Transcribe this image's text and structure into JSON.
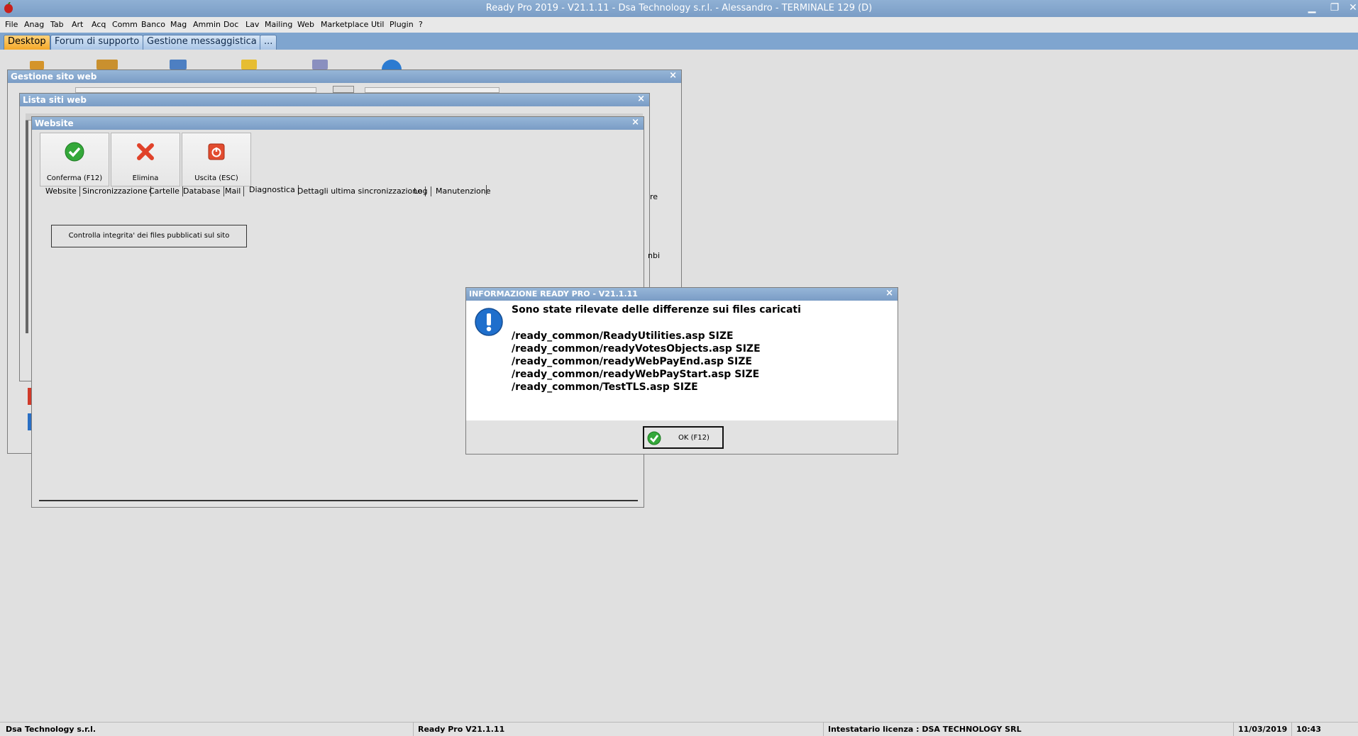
{
  "window": {
    "title": "Ready Pro 2019 - V21.1.11 - Dsa Technology s.r.l. - Alessandro - TERMINALE 129 (D)",
    "minimize_glyph": "▁",
    "restore_glyph": "❐",
    "close_glyph": "✕"
  },
  "menu": [
    "File",
    "Anag",
    "Tab",
    "Art",
    "Acq",
    "Comm",
    "Banco",
    "Mag",
    "Ammin",
    "Doc",
    "Lav",
    "Mailing",
    "Web",
    "Marketplace",
    "Util",
    "Plugin",
    "?"
  ],
  "tabs": [
    "Desktop",
    "Forum di supporto",
    "Gestione messaggistica",
    "..."
  ],
  "gestione_sito": {
    "title": "Gestione sito web"
  },
  "lista_siti": {
    "title": "Lista siti web",
    "side_text_1": "re",
    "side_text_2": "nbi"
  },
  "website": {
    "title": "Website",
    "buttons": [
      "Conferma (F12)",
      "Elimina",
      "Uscita (ESC)"
    ],
    "tabs": [
      "Website",
      "Sincronizzazione",
      "Cartelle",
      "Database",
      "Mail",
      "Diagnostica",
      "Dettagli ultima sincronizzazione",
      "Log",
      "Manutenzione"
    ],
    "check_button": "Controlla integrita' dei files pubblicati sul sito"
  },
  "info_dialog": {
    "title": "INFORMAZIONE READY PRO - V21.1.11",
    "heading": "Sono state rilevate delle differenze sui files caricati",
    "files": [
      "/ready_common/ReadyUtilities.asp SIZE",
      "/ready_common/readyVotesObjects.asp SIZE",
      "/ready_common/readyWebPayEnd.asp SIZE",
      "/ready_common/readyWebPayStart.asp SIZE",
      "/ready_common/TestTLS.asp SIZE"
    ],
    "ok_label": "OK (F12)"
  },
  "close_x": "×",
  "status": {
    "company": "Dsa Technology s.r.l.",
    "version": "Ready Pro V21.1.11",
    "license": "Intestatario licenza : DSA TECHNOLOGY SRL",
    "date": "11/03/2019",
    "time": "10:43"
  },
  "colors": {
    "title_bar": "#7a9dc6",
    "active_tab": "#f4a829",
    "info_icon": "#1f6fcc"
  }
}
